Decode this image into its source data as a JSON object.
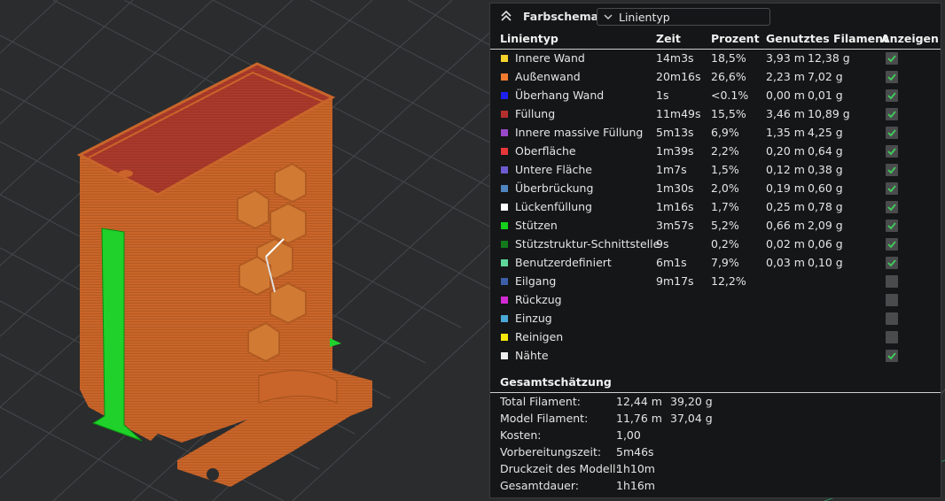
{
  "panel": {
    "title": "Farbschema",
    "dropdown_value": "Linientyp",
    "columns": [
      "Linientyp",
      "Zeit",
      "Prozent",
      "Genutztes Filament",
      "Anzeigen"
    ],
    "rows": [
      {
        "name": "Innere Wand",
        "color": "#f3d32a",
        "time": "14m3s",
        "percent": "18,5%",
        "length": "3,93 m",
        "weight": "12,38 g",
        "shown": true
      },
      {
        "name": "Außenwand",
        "color": "#f07b2e",
        "time": "20m16s",
        "percent": "26,6%",
        "length": "2,23 m",
        "weight": "7,02 g",
        "shown": true
      },
      {
        "name": "Überhang Wand",
        "color": "#1c20f0",
        "time": "1s",
        "percent": "<0.1%",
        "length": "0,00 m",
        "weight": "0,01 g",
        "shown": true
      },
      {
        "name": "Füllung",
        "color": "#b52e2e",
        "time": "11m49s",
        "percent": "15,5%",
        "length": "3,46 m",
        "weight": "10,89 g",
        "shown": true
      },
      {
        "name": "Innere massive Füllung",
        "color": "#9a48c8",
        "time": "5m13s",
        "percent": "6,9%",
        "length": "1,35 m",
        "weight": "4,25 g",
        "shown": true
      },
      {
        "name": "Oberfläche",
        "color": "#e8383b",
        "time": "1m39s",
        "percent": "2,2%",
        "length": "0,20 m",
        "weight": "0,64 g",
        "shown": true
      },
      {
        "name": "Untere Fläche",
        "color": "#6e5ad0",
        "time": "1m7s",
        "percent": "1,5%",
        "length": "0,12 m",
        "weight": "0,38 g",
        "shown": true
      },
      {
        "name": "Überbrückung",
        "color": "#4f86c0",
        "time": "1m30s",
        "percent": "2,0%",
        "length": "0,19 m",
        "weight": "0,60 g",
        "shown": true
      },
      {
        "name": "Lückenfüllung",
        "color": "#ffffff",
        "time": "1m16s",
        "percent": "1,7%",
        "length": "0,25 m",
        "weight": "0,78 g",
        "shown": true
      },
      {
        "name": "Stützen",
        "color": "#14d11c",
        "time": "3m57s",
        "percent": "5,2%",
        "length": "0,66 m",
        "weight": "2,09 g",
        "shown": true
      },
      {
        "name": "Stützstruktur-Schnittstelle",
        "color": "#127a1a",
        "time": "9s",
        "percent": "0,2%",
        "length": "0,02 m",
        "weight": "0,06 g",
        "shown": true
      },
      {
        "name": "Benutzerdefiniert",
        "color": "#5ed69a",
        "time": "6m1s",
        "percent": "7,9%",
        "length": "0,03 m",
        "weight": "0,10 g",
        "shown": true
      },
      {
        "name": "Eilgang",
        "color": "#3c5fa8",
        "time": "9m17s",
        "percent": "12,2%",
        "length": "",
        "weight": "",
        "shown": false
      },
      {
        "name": "Rückzug",
        "color": "#d22ad2",
        "time": "",
        "percent": "",
        "length": "",
        "weight": "",
        "shown": false
      },
      {
        "name": "Einzug",
        "color": "#4aa9d6",
        "time": "",
        "percent": "",
        "length": "",
        "weight": "",
        "shown": false
      },
      {
        "name": "Reinigen",
        "color": "#f5e80c",
        "time": "",
        "percent": "",
        "length": "",
        "weight": "",
        "shown": false
      },
      {
        "name": "Nähte",
        "color": "#eeeeee",
        "time": "",
        "percent": "",
        "length": "",
        "weight": "",
        "shown": true
      }
    ]
  },
  "summary": {
    "title": "Gesamtschätzung",
    "rows": [
      {
        "label": "Total Filament:",
        "v1": "12,44 m",
        "v2": "39,20 g"
      },
      {
        "label": "Model Filament:",
        "v1": "11,76 m",
        "v2": "37,04 g"
      },
      {
        "label": "Kosten:",
        "v1": "1,00",
        "v2": ""
      },
      {
        "label": "Vorbereitungszeit:",
        "v1": "5m46s",
        "v2": ""
      },
      {
        "label": "Druckzeit des Modell:",
        "v1": "1h10m",
        "v2": ""
      },
      {
        "label": "Gesamtdauer:",
        "v1": "1h16m",
        "v2": ""
      }
    ]
  },
  "viewport": {
    "background": "#2b2c2e",
    "wall_color": "#c9652a",
    "top_color": "#a93a2c",
    "support_color": "#1fd12a"
  }
}
